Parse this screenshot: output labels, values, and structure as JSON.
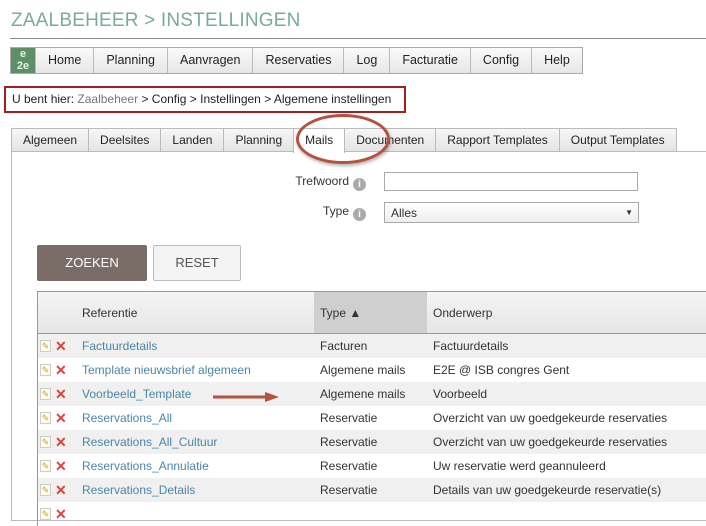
{
  "title": "ZAALBEHEER > INSTELLINGEN",
  "nav": {
    "logo": "e2e",
    "items": [
      "Home",
      "Planning",
      "Aanvragen",
      "Reservaties",
      "Log",
      "Facturatie",
      "Config",
      "Help"
    ]
  },
  "breadcrumb": {
    "prefix": "U bent hier:",
    "home": "Zaalbeheer",
    "rest": " > Config > Instellingen > Algemene instellingen"
  },
  "tabs": [
    "Algemeen",
    "Deelsites",
    "Landen",
    "Planning",
    "Mails",
    "Documenten",
    "Rapport Templates",
    "Output Templates"
  ],
  "active_tab": "Mails",
  "form": {
    "trefwoord_label": "Trefwoord",
    "trefwoord_value": "",
    "type_label": "Type",
    "type_value": "Alles"
  },
  "buttons": {
    "search": "ZOEKEN",
    "reset": "RESET"
  },
  "table": {
    "headers": [
      "Referentie",
      "Type ▲",
      "Onderwerp"
    ],
    "rows": [
      [
        "Factuurdetails",
        "Facturen",
        "Factuurdetails"
      ],
      [
        "Template nieuwsbrief algemeen",
        "Algemene mails",
        "E2E @ ISB congres Gent"
      ],
      [
        "Voorbeeld_Template",
        "Algemene mails",
        "Voorbeeld"
      ],
      [
        "Reservations_All",
        "Reservatie",
        "Overzicht van uw goedgekeurde reservaties"
      ],
      [
        "Reservations_All_Cultuur",
        "Reservatie",
        "Overzicht van uw goedgekeurde reservaties"
      ],
      [
        "Reservations_Annulatie",
        "Reservatie",
        "Uw reservatie werd geannuleerd"
      ],
      [
        "Reservations_Details",
        "Reservatie",
        "Details van uw goedgekeurde reservatie(s)"
      ],
      [
        "",
        "",
        ""
      ]
    ]
  },
  "colors": {
    "title": "#7aa9a0",
    "annotation": "#a31f24",
    "search_button": "#7a6d68",
    "link": "#4a86a8"
  }
}
